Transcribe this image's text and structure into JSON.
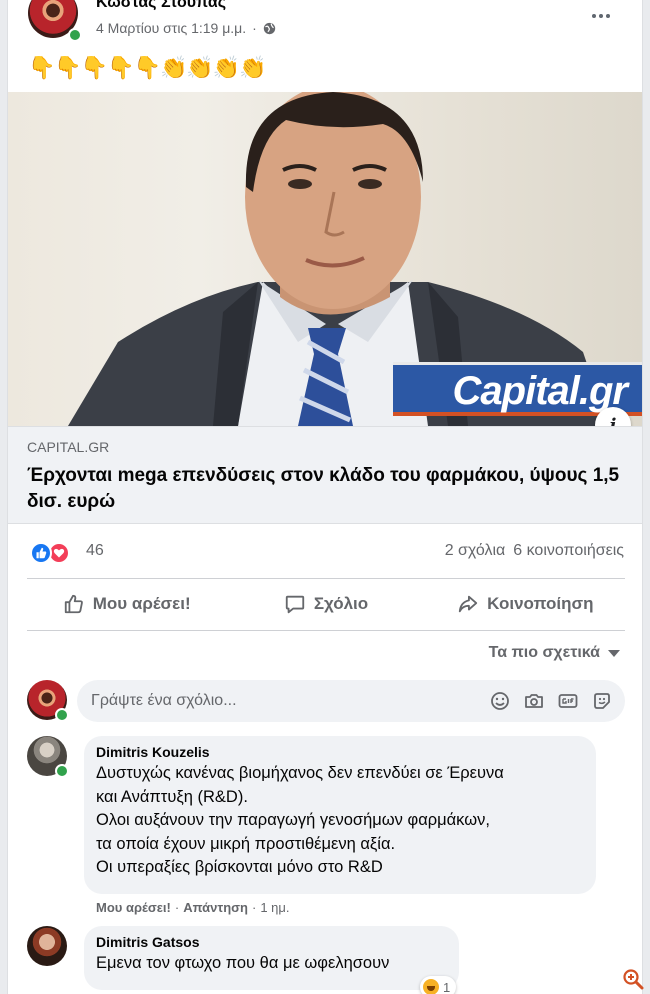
{
  "post": {
    "author": "Κωστας Στουπας",
    "date": "4 Μαρτίου στις 1:19 μ.μ.",
    "privacy_icon": "globe-icon",
    "text": "👇👇👇👇👇👏👏👏👏"
  },
  "link": {
    "image_logo": "Capital.gr",
    "domain": "CAPITAL.GR",
    "title": "Έρχονται mega επενδύσεις στον κλάδο του φαρμάκου, ύψους 1,5 δισ. ευρώ"
  },
  "stats": {
    "reaction_count": "46",
    "comments": "2 σχόλια",
    "shares": "6 κοινοποιήσεις"
  },
  "actions": {
    "like": "Μου αρέσει!",
    "comment": "Σχόλιο",
    "share": "Κοινοποίηση"
  },
  "sort_label": "Τα πιο σχετικά",
  "composer": {
    "placeholder": "Γράψτε ένα σχόλιο..."
  },
  "comments": [
    {
      "author": "Dimitris Kouzelis",
      "lines": [
        "Δυστυχώς κανένας βιομήχανος δεν επενδύει σε Έρευνα",
        "και Ανάπτυξη (R&D).",
        "Ολοι αυξάνουν την παραγωγή γενοσήμων φαρμάκων,",
        "τα οποία έχουν μικρή προστιθέμενη αξία.",
        "Οι υπεραξίες βρίσκονται μόνο στο R&D"
      ],
      "like": "Μου αρέσει!",
      "reply": "Απάντηση",
      "time": "1 ημ."
    },
    {
      "author": "Dimitris Gatsos",
      "lines": [
        "Εμενα τον φτωχο που θα με ωφελησουν"
      ],
      "reaction_count": "1"
    }
  ],
  "colors": {
    "accent": "#1877f2",
    "love": "#f33e58",
    "muted": "#65676b",
    "bubble": "#f0f2f5",
    "online": "#31a24c"
  }
}
